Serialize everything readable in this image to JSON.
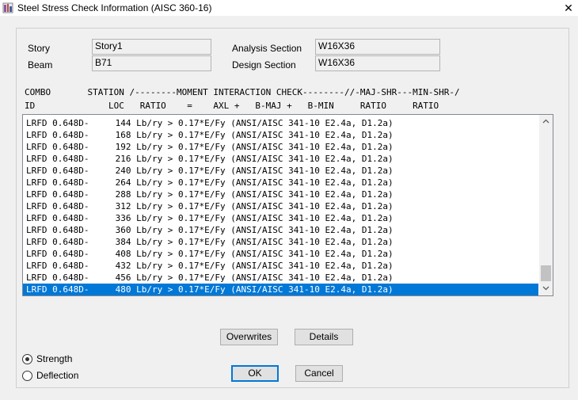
{
  "window": {
    "title": "Steel Stress Check Information (AISC 360-16)",
    "close_glyph": "✕"
  },
  "info": {
    "story_label": "Story",
    "story_value": "Story1",
    "beam_label": "Beam",
    "beam_value": "B71",
    "analysis_label": "Analysis Section",
    "analysis_value": "W16X36",
    "design_label": "Design Section",
    "design_value": "W16X36"
  },
  "table_header": {
    "line1": "COMBO       STATION /--------MOMENT INTERACTION CHECK--------//-MAJ-SHR---MIN-SHR-/",
    "line2": "ID              LOC   RATIO    =    AXL +   B-MAJ +   B-MIN     RATIO     RATIO"
  },
  "rows": [
    {
      "combo": "LRFD 0.648D-",
      "loc": "144",
      "text": "Lb/ry > 0.17*E/Fy (ANSI/AISC 341-10 E2.4a, D1.2a)"
    },
    {
      "combo": "LRFD 0.648D-",
      "loc": "168",
      "text": "Lb/ry > 0.17*E/Fy (ANSI/AISC 341-10 E2.4a, D1.2a)"
    },
    {
      "combo": "LRFD 0.648D-",
      "loc": "192",
      "text": "Lb/ry > 0.17*E/Fy (ANSI/AISC 341-10 E2.4a, D1.2a)"
    },
    {
      "combo": "LRFD 0.648D-",
      "loc": "216",
      "text": "Lb/ry > 0.17*E/Fy (ANSI/AISC 341-10 E2.4a, D1.2a)"
    },
    {
      "combo": "LRFD 0.648D-",
      "loc": "240",
      "text": "Lb/ry > 0.17*E/Fy (ANSI/AISC 341-10 E2.4a, D1.2a)"
    },
    {
      "combo": "LRFD 0.648D-",
      "loc": "264",
      "text": "Lb/ry > 0.17*E/Fy (ANSI/AISC 341-10 E2.4a, D1.2a)"
    },
    {
      "combo": "LRFD 0.648D-",
      "loc": "288",
      "text": "Lb/ry > 0.17*E/Fy (ANSI/AISC 341-10 E2.4a, D1.2a)"
    },
    {
      "combo": "LRFD 0.648D-",
      "loc": "312",
      "text": "Lb/ry > 0.17*E/Fy (ANSI/AISC 341-10 E2.4a, D1.2a)"
    },
    {
      "combo": "LRFD 0.648D-",
      "loc": "336",
      "text": "Lb/ry > 0.17*E/Fy (ANSI/AISC 341-10 E2.4a, D1.2a)"
    },
    {
      "combo": "LRFD 0.648D-",
      "loc": "360",
      "text": "Lb/ry > 0.17*E/Fy (ANSI/AISC 341-10 E2.4a, D1.2a)"
    },
    {
      "combo": "LRFD 0.648D-",
      "loc": "384",
      "text": "Lb/ry > 0.17*E/Fy (ANSI/AISC 341-10 E2.4a, D1.2a)"
    },
    {
      "combo": "LRFD 0.648D-",
      "loc": "408",
      "text": "Lb/ry > 0.17*E/Fy (ANSI/AISC 341-10 E2.4a, D1.2a)"
    },
    {
      "combo": "LRFD 0.648D-",
      "loc": "432",
      "text": "Lb/ry > 0.17*E/Fy (ANSI/AISC 341-10 E2.4a, D1.2a)"
    },
    {
      "combo": "LRFD 0.648D-",
      "loc": "456",
      "text": "Lb/ry > 0.17*E/Fy (ANSI/AISC 341-10 E2.4a, D1.2a)"
    },
    {
      "combo": "LRFD 0.648D-",
      "loc": "480",
      "text": "Lb/ry > 0.17*E/Fy (ANSI/AISC 341-10 E2.4a, D1.2a)",
      "selected": true
    }
  ],
  "buttons": {
    "overwrites": "Overwrites",
    "details": "Details",
    "ok": "OK",
    "cancel": "Cancel"
  },
  "options": {
    "strength": "Strength",
    "deflection": "Deflection",
    "selected": "strength"
  },
  "icons": {
    "app": "steel-frame-icon",
    "scroll_up": "chevron-up-icon",
    "scroll_down": "chevron-down-icon"
  },
  "colors": {
    "selection": "#0078d7"
  }
}
